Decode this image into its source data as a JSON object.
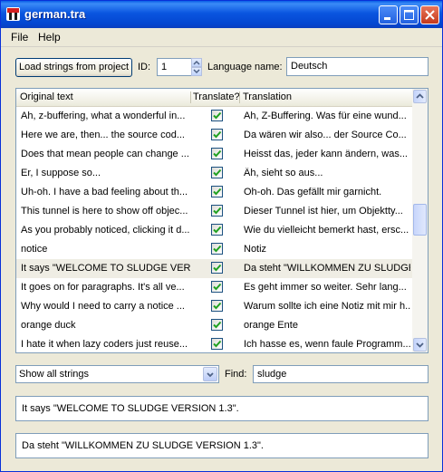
{
  "window": {
    "title": "german.tra",
    "colors": {
      "titlebar": "#0a55e0",
      "close": "#c4391c",
      "checkbox_tick": "#21a121",
      "selected_row": "#efede4"
    }
  },
  "menu": [
    {
      "label": "File"
    },
    {
      "label": "Help"
    }
  ],
  "toolbar": {
    "load_button": "Load strings from project",
    "id_label": "ID:",
    "id_value": "1",
    "language_label": "Language name:",
    "language_value": "Deutsch"
  },
  "table": {
    "columns": [
      "Original text",
      "Translate?",
      "Translation"
    ],
    "rows": [
      {
        "original": "Ah, z-buffering, what a wonderful in...",
        "translate": true,
        "translation": "Ah, Z-Buffering. Was für eine wund...",
        "selected": false
      },
      {
        "original": "Here we are, then... the source cod...",
        "translate": true,
        "translation": "Da wären wir also... der Source Co...",
        "selected": false
      },
      {
        "original": "Does that mean people can change ...",
        "translate": true,
        "translation": "Heisst das, jeder kann ändern, was...",
        "selected": false
      },
      {
        "original": "Er, I suppose so...",
        "translate": true,
        "translation": "Äh, sieht so aus...",
        "selected": false
      },
      {
        "original": "Uh-oh. I have a bad feeling about th...",
        "translate": true,
        "translation": "Oh-oh. Das gefällt mir garnicht.",
        "selected": false
      },
      {
        "original": "This tunnel is here to show off objec...",
        "translate": true,
        "translation": "Dieser Tunnel ist hier, um Objektty...",
        "selected": false
      },
      {
        "original": "As you probably noticed, clicking it d...",
        "translate": true,
        "translation": "Wie du vielleicht bemerkt hast, ersc...",
        "selected": false
      },
      {
        "original": "notice",
        "translate": true,
        "translation": "Notiz",
        "selected": false
      },
      {
        "original": "It says \"WELCOME TO SLUDGE VERS...",
        "translate": true,
        "translation": "Da steht \"WILLKOMMEN ZU SLUDGE...",
        "selected": true
      },
      {
        "original": "It goes on for paragraphs. It's all ve...",
        "translate": true,
        "translation": "Es geht immer so weiter. Sehr lang...",
        "selected": false
      },
      {
        "original": "Why would I need to carry a notice ...",
        "translate": true,
        "translation": "Warum sollte ich eine Notiz mit mir h...",
        "selected": false
      },
      {
        "original": "orange duck",
        "translate": true,
        "translation": "orange Ente",
        "selected": false
      },
      {
        "original": "I hate it when lazy coders just reuse...",
        "translate": true,
        "translation": "Ich hasse es, wenn faule Programm...",
        "selected": false
      }
    ]
  },
  "filter": {
    "selected": "Show all strings",
    "find_label": "Find:",
    "find_value": "sludge"
  },
  "detail": {
    "original_full": "It says \"WELCOME TO SLUDGE VERSION 1.3\".",
    "translation_full": "Da steht \"WILLKOMMEN ZU SLUDGE VERSION 1.3\"."
  }
}
